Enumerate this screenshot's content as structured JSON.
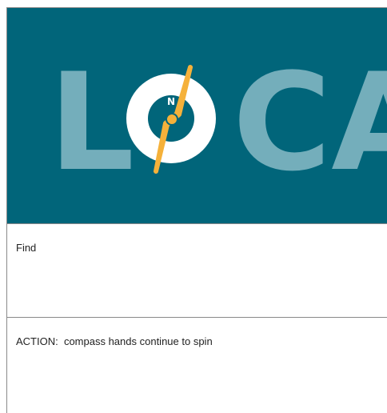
{
  "hero": {
    "logo_word": "LOCA",
    "compass_north_label": "N",
    "colors": {
      "background": "#01657a",
      "letters": "#74aebb",
      "compass_ring": "#ffffff",
      "needle": "#f5b13a"
    },
    "icon": "compass-icon"
  },
  "find_panel": {
    "label": "Find"
  },
  "action_panel": {
    "label": "ACTION:  compass hands continue to spin"
  }
}
